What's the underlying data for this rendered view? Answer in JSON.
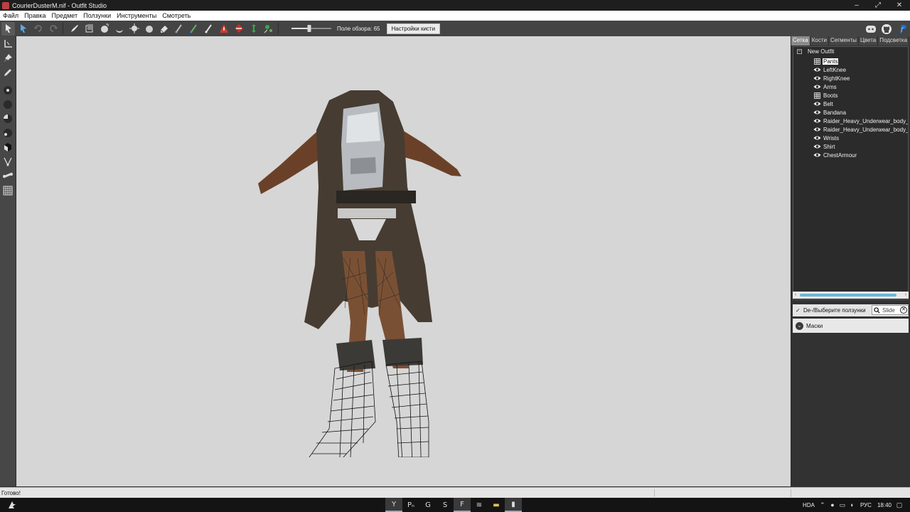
{
  "window": {
    "title": "CourierDusterM.nif - Outfit Studio",
    "controls": [
      "–",
      "⤢",
      "✕"
    ]
  },
  "menu": {
    "items": [
      "Файл",
      "Правка",
      "Предмет",
      "Ползунки",
      "Инструменты",
      "Смотреть"
    ]
  },
  "toolbar": {
    "fov_label": "Поле обзора: 65",
    "fov_value": 65,
    "fov_slider_fraction": 0.45,
    "brush_settings_label": "Настройки кисти",
    "right_icons": [
      "discord-icon",
      "github-icon",
      "paypal-icon"
    ],
    "colors": {
      "accent": "#3d8fd6",
      "warning_red": "#d23a2a",
      "green": "#3aa84a"
    }
  },
  "right_panel": {
    "tabs": [
      "Сетка",
      "Кости",
      "Сегменты",
      "Цвета",
      "Подсветка"
    ],
    "active_tab": "Сетка",
    "tree": {
      "root_label": "New Outfit",
      "collapse_symbol": "−",
      "items": [
        {
          "label": "Pants",
          "icon": "grid-icon",
          "selected": true
        },
        {
          "label": "LeftKnee",
          "icon": "eye-icon"
        },
        {
          "label": "RightKnee",
          "icon": "eye-icon"
        },
        {
          "label": "Arms",
          "icon": "eye-icon"
        },
        {
          "label": "Boots",
          "icon": "grid-icon"
        },
        {
          "label": "Belt",
          "icon": "eye-icon"
        },
        {
          "label": "Bandana",
          "icon": "eye-icon"
        },
        {
          "label": "Raider_Heavy_Underwear_body_Cl",
          "icon": "eye-icon"
        },
        {
          "label": "Raider_Heavy_Underwear_body_Cl",
          "icon": "eye-icon"
        },
        {
          "label": "Wrists",
          "icon": "eye-icon"
        },
        {
          "label": "Shirt",
          "icon": "eye-icon"
        },
        {
          "label": "ChestArmour",
          "icon": "eye-icon"
        }
      ]
    },
    "slider_filter": {
      "checkbox_label": "De-/Выберите ползунки",
      "checked": true,
      "search_placeholder": "Slide"
    },
    "masks_label": "Маски"
  },
  "status": {
    "text": "Готово!"
  },
  "taskbar": {
    "task_glyphs": [
      "Y",
      "Pₙ",
      "G",
      "S",
      "F",
      "≋",
      "▬",
      "▮"
    ],
    "tray": {
      "lang_indicator": "HDA",
      "language": "РУС",
      "time": "18:40"
    }
  }
}
